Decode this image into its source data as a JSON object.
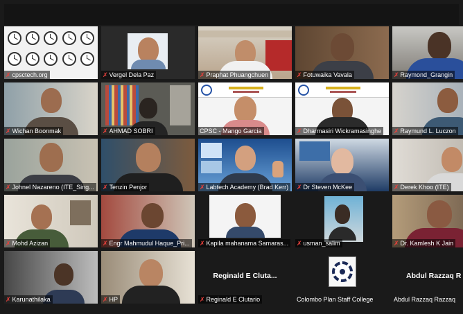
{
  "app": "Zoom gallery view",
  "colors": {
    "background": "#1a1a1a",
    "name_text": "#ffffff",
    "muted_mic": "#e8413c",
    "active_speaker_border": "#9ad81f"
  },
  "icons": {
    "muted_mic": "microphone-muted-icon"
  },
  "participants": [
    {
      "name": "cpsctech.org",
      "muted": true,
      "video": "world-clocks"
    },
    {
      "name": "Vergel Dela Paz",
      "muted": true,
      "video": "camera"
    },
    {
      "name": "Praphat  Phuangchuen",
      "muted": true,
      "video": "camera"
    },
    {
      "name": "Fotuwaika Vavala",
      "muted": true,
      "video": "camera"
    },
    {
      "name": "Raymond_Grangin",
      "muted": true,
      "video": "camera"
    },
    {
      "name": "Wichan Boonmak",
      "muted": true,
      "video": "camera"
    },
    {
      "name": "AHMAD SOBRI",
      "muted": true,
      "video": "camera"
    },
    {
      "name": "CPSC - Mango Garcia",
      "muted": false,
      "video": "camera",
      "active_speaker": true
    },
    {
      "name": "Dharmasiri Wickramasinghe",
      "muted": true,
      "video": "camera"
    },
    {
      "name": "Raymund L. Luczon",
      "muted": true,
      "video": "camera"
    },
    {
      "name": "Johnel Nazareno (ITE_Sing...",
      "muted": true,
      "video": "camera"
    },
    {
      "name": "Tenzin Penjor",
      "muted": true,
      "video": "camera"
    },
    {
      "name": "Labtech Academy (Brad Kerr)",
      "muted": true,
      "video": "camera"
    },
    {
      "name": "Dr Steven McKee",
      "muted": true,
      "video": "camera"
    },
    {
      "name": "Derek Khoo (ITE)",
      "muted": true,
      "video": "camera"
    },
    {
      "name": "Mohd Azizan",
      "muted": true,
      "video": "camera"
    },
    {
      "name": "Engr Mahmudul Haque_Pri...",
      "muted": true,
      "video": "camera"
    },
    {
      "name": "Kapila mahanama Samaras...",
      "muted": true,
      "video": "camera"
    },
    {
      "name": "usman_salim",
      "muted": true,
      "video": "camera"
    },
    {
      "name": "Dr. Kamlesh K Jain",
      "muted": true,
      "video": "camera"
    },
    {
      "name": "Karunathilaka",
      "muted": true,
      "video": "camera"
    },
    {
      "name": "HP",
      "muted": true,
      "video": "camera"
    },
    {
      "name": "Reginald E Clutario",
      "muted": true,
      "video": "off",
      "display_name": "Reginald E Cluta..."
    },
    {
      "name": "Colombo Plan Staff College",
      "muted": true,
      "video": "logo"
    },
    {
      "name": "Abdul Razzaq Razzaq",
      "muted": true,
      "video": "off",
      "display_name": "Abdul Razzaq R"
    }
  ]
}
